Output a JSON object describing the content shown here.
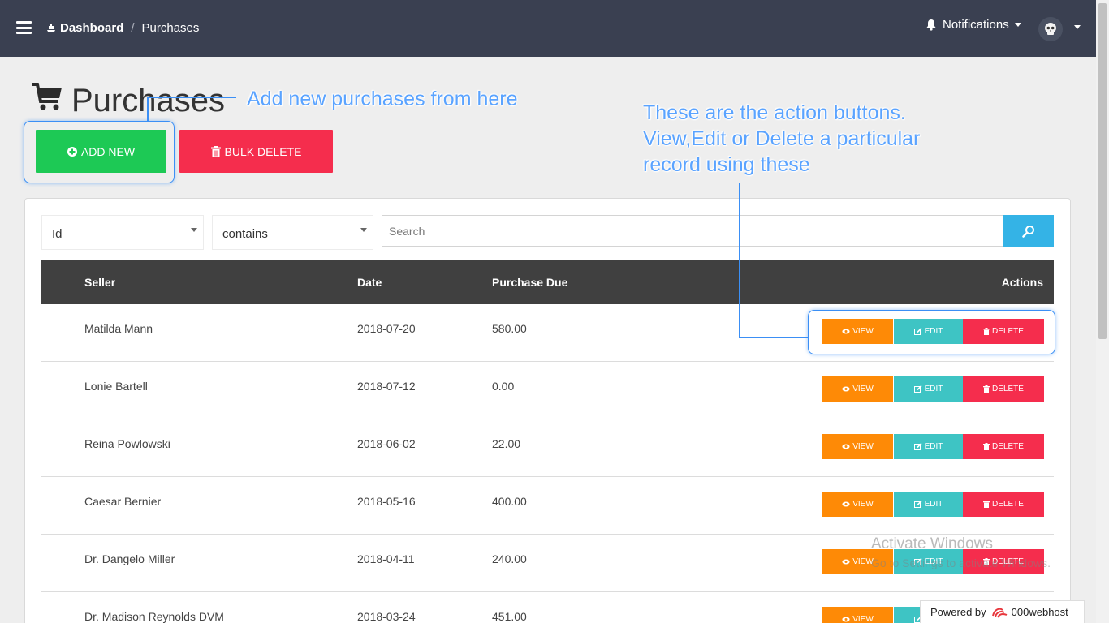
{
  "topbar": {
    "breadcrumb_home": "Dashboard",
    "breadcrumb_separator": "/",
    "breadcrumb_current": "Purchases",
    "notifications_label": "Notifications"
  },
  "page": {
    "title": "Purchases",
    "add_new_label": "ADD NEW",
    "bulk_delete_label": "BULK DELETE"
  },
  "filters": {
    "field_value": "Id",
    "operator_value": "contains",
    "search_placeholder": "Search"
  },
  "table": {
    "headers": {
      "seller": "Seller",
      "date": "Date",
      "purchase_due": "Purchase Due",
      "actions": "Actions"
    },
    "action_labels": {
      "view": "VIEW",
      "edit": "EDIT",
      "delete": "DELETE"
    },
    "rows": [
      {
        "seller": "Matilda Mann",
        "date": "2018-07-20",
        "purchase_due": "580.00"
      },
      {
        "seller": "Lonie Bartell",
        "date": "2018-07-12",
        "purchase_due": "0.00"
      },
      {
        "seller": "Reina Powlowski",
        "date": "2018-06-02",
        "purchase_due": "22.00"
      },
      {
        "seller": "Caesar Bernier",
        "date": "2018-05-16",
        "purchase_due": "400.00"
      },
      {
        "seller": "Dr. Dangelo Miller",
        "date": "2018-04-11",
        "purchase_due": "240.00"
      },
      {
        "seller": "Dr. Madison Reynolds DVM",
        "date": "2018-03-24",
        "purchase_due": "451.00"
      }
    ]
  },
  "annotations": {
    "add_note": "Add new purchases from here",
    "action_note_lines": [
      "These are the action buttons.",
      "View,Edit or Delete a particular",
      "record using these"
    ]
  },
  "overlay": {
    "watermark_title": "Activate Windows",
    "watermark_sub": "Go to Settings to activate Windows.",
    "powered_by": "Powered by",
    "host_brand": "000webhost"
  },
  "icons": {
    "menu": "hamburger-icon",
    "dashboard": "ship-icon",
    "notifications": "bell-icon",
    "avatar": "skull-icon",
    "page": "cart-icon",
    "add": "plus-circle-icon",
    "bulk_delete": "trash-icon",
    "search": "search-icon",
    "view": "eye-icon",
    "edit": "edit-icon",
    "delete": "trash-icon"
  },
  "colors": {
    "topbar": "#3a4051",
    "add_button": "#1dc955",
    "delete_button": "#f52d4d",
    "view_button": "#fe8a06",
    "edit_button": "#3ec4c4",
    "search_button": "#34b3e6",
    "table_header": "#404040",
    "annotation": "#5aa3ff"
  }
}
